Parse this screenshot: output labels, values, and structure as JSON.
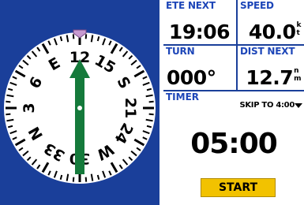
{
  "compass": {
    "heading_deg": 0,
    "labels": [
      {
        "text": "N",
        "angle": 240
      },
      {
        "text": "33",
        "angle": 210
      },
      {
        "text": "30",
        "angle": 180
      },
      {
        "text": "W",
        "angle": 150
      },
      {
        "text": "24",
        "angle": 120
      },
      {
        "text": "21",
        "angle": 90
      },
      {
        "text": "S",
        "angle": 60
      },
      {
        "text": "15",
        "angle": 30
      },
      {
        "text": "12",
        "angle": 0
      },
      {
        "text": "E",
        "angle": 330
      },
      {
        "text": "6",
        "angle": 300
      },
      {
        "text": "3",
        "angle": 270
      }
    ],
    "colors": {
      "background": "#1a3f9a",
      "dial": "#ffffff",
      "ticks": "#000000",
      "pointer": "#157a3b",
      "lubber": "#c79ad0"
    }
  },
  "fields": {
    "ete_next": {
      "label": "ETE NEXT",
      "value": "19:06"
    },
    "speed": {
      "label": "SPEED",
      "value": "40.0",
      "unit_top": "k",
      "unit_bottom": "t"
    },
    "turn": {
      "label": "TURN",
      "value": "000°"
    },
    "dist_next": {
      "label": "DIST NEXT",
      "value": "12.7",
      "unit_top": "n",
      "unit_bottom": "m"
    }
  },
  "timer": {
    "label": "TIMER",
    "skip_label": "SKIP TO 4:00",
    "value": "05:00",
    "start_label": "START"
  }
}
